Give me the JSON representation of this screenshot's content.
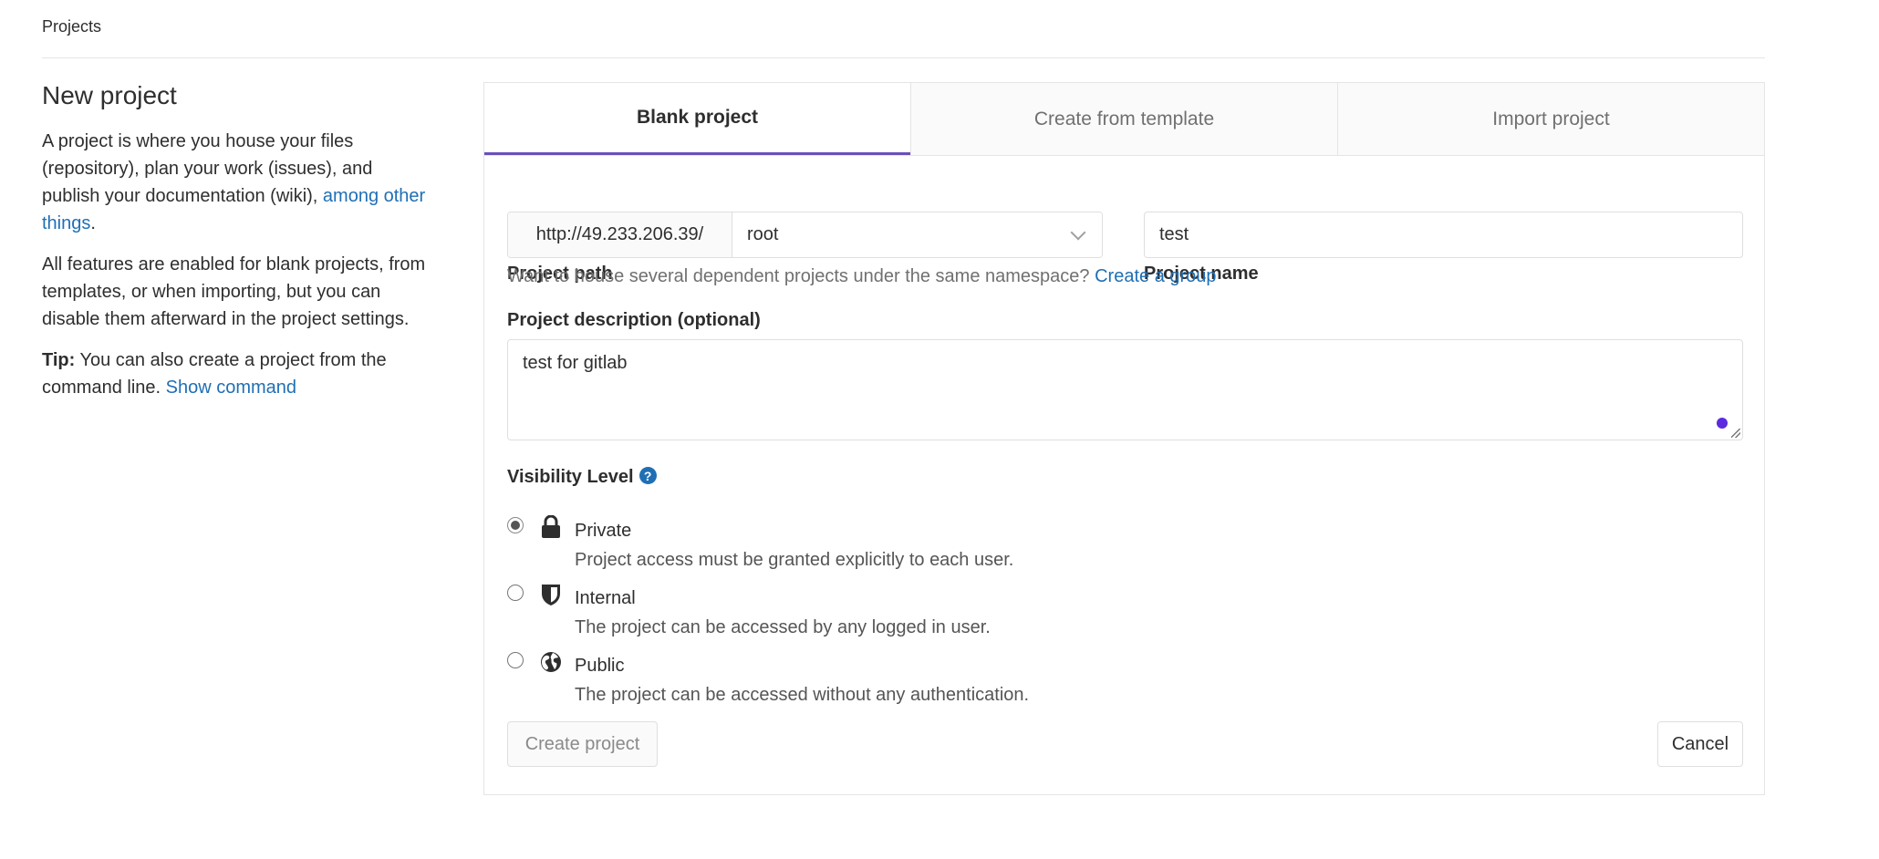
{
  "breadcrumb": {
    "label": "Projects"
  },
  "intro": {
    "title": "New project",
    "para1_text": "A project is where you house your files (repository), plan your work (issues), and publish your documentation (wiki), ",
    "para1_link": "among other things",
    "para1_end": ".",
    "para2": "All features are enabled for blank projects, from templates, or when importing, but you can disable them afterward in the project settings.",
    "tip_label": "Tip:",
    "tip_text": " You can also create a project from the command line. ",
    "tip_link": "Show command"
  },
  "tabs": [
    {
      "label": "Blank project",
      "active": true
    },
    {
      "label": "Create from template",
      "active": false
    },
    {
      "label": "Import project",
      "active": false
    }
  ],
  "form": {
    "project_path": {
      "label": "Project path",
      "prefix": "http://49.233.206.39/",
      "namespace": "root"
    },
    "project_name": {
      "label": "Project name",
      "value": "test"
    },
    "namespace_help": {
      "text": "Want to house several dependent projects under the same namespace? ",
      "link": "Create a group"
    },
    "description": {
      "label": "Project description (optional)",
      "value": "test for gitlab"
    },
    "visibility": {
      "label": "Visibility Level",
      "help_icon": "?",
      "options": [
        {
          "title": "Private",
          "description": "Project access must be granted explicitly to each user.",
          "icon": "lock-icon",
          "checked": true
        },
        {
          "title": "Internal",
          "description": "The project can be accessed by any logged in user.",
          "icon": "shield-icon",
          "checked": false
        },
        {
          "title": "Public",
          "description": "The project can be accessed without any authentication.",
          "icon": "globe-icon",
          "checked": false
        }
      ]
    },
    "buttons": {
      "create": "Create project",
      "cancel": "Cancel"
    }
  },
  "colors": {
    "link": "#1f6fb5",
    "tab_active_border": "#6b4fbb",
    "grammar_dot": "#5b2bdd"
  }
}
